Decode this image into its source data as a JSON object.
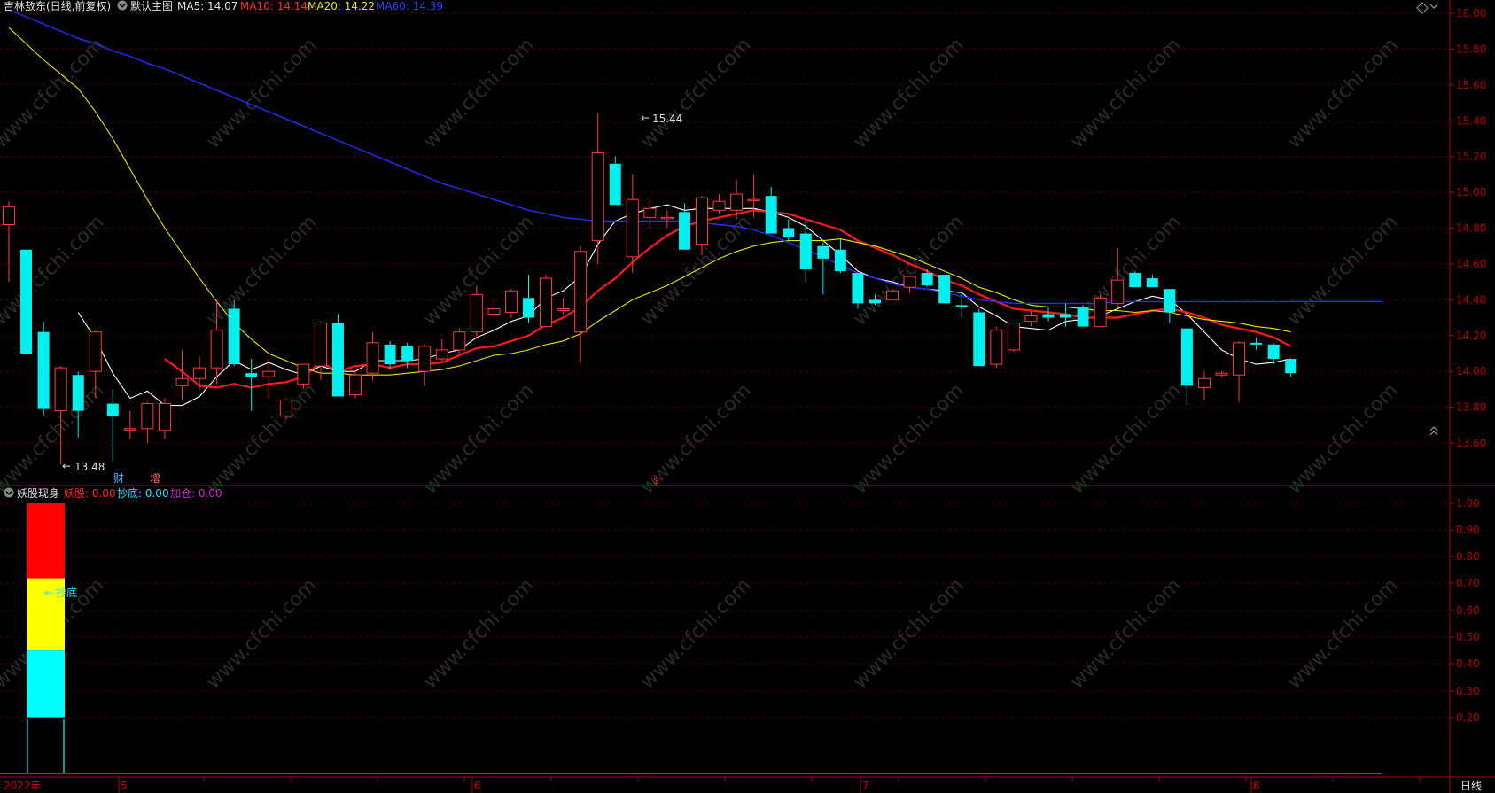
{
  "main_header": {
    "stock": "吉林敖东(日线,前复权)",
    "chart_name": "默认主图",
    "ma5": "MA5: 14.07",
    "ma10": "MA10: 14.14",
    "ma20": "MA20: 14.22",
    "ma60": "MA60: 14.39"
  },
  "indicator_header": {
    "name": "妖股现身",
    "yaogu": "妖股: 0.00",
    "chaodi": "抄底: 0.00",
    "jiacang": "加仓: 0.00"
  },
  "annotations": {
    "high": "15.44",
    "low": "13.48",
    "cai": "财",
    "zeng": "增",
    "chaodi_mark": "抄底",
    "dollar": "$"
  },
  "time_axis": {
    "labels": [
      "2022年",
      "5",
      "6",
      "7",
      "8"
    ],
    "period": "日线"
  },
  "watermark": "www.cfchi.com",
  "colors": {
    "up": "#ff3b3b",
    "down": "#00f0f0",
    "ma5": "#ffffff",
    "ma10": "#ff1a1a",
    "ma20": "#e6e600",
    "ma60": "#2030ff",
    "axis": "#b00000",
    "purple": "#cc00cc"
  },
  "chart_data": [
    {
      "type": "candlestick",
      "title": "吉林敖东(日线,前复权)",
      "y_ticks": [
        "16.00",
        "15.80",
        "15.60",
        "15.40",
        "15.20",
        "15.00",
        "14.80",
        "14.60",
        "14.40",
        "14.20",
        "14.00",
        "13.80",
        "13.60"
      ],
      "ylim": [
        13.45,
        16.05
      ],
      "candles": [
        [
          14.82,
          14.95,
          14.5,
          14.92
        ],
        [
          14.68,
          14.68,
          14.1,
          14.1
        ],
        [
          14.22,
          14.28,
          13.75,
          13.79
        ],
        [
          13.78,
          14.03,
          13.48,
          14.02
        ],
        [
          13.98,
          14.0,
          13.63,
          13.78
        ],
        [
          14.0,
          14.23,
          13.85,
          14.22
        ],
        [
          13.82,
          13.9,
          13.5,
          13.75
        ],
        [
          13.68,
          13.78,
          13.62,
          13.68
        ],
        [
          13.68,
          13.83,
          13.6,
          13.82
        ],
        [
          13.67,
          13.85,
          13.62,
          13.82
        ],
        [
          13.92,
          14.12,
          13.84,
          13.96
        ],
        [
          13.96,
          14.08,
          13.9,
          14.02
        ],
        [
          14.02,
          14.4,
          13.93,
          14.23
        ],
        [
          14.35,
          14.4,
          14.03,
          14.04
        ],
        [
          13.99,
          14.07,
          13.78,
          13.97
        ],
        [
          13.97,
          14.07,
          13.85,
          14.0
        ],
        [
          13.75,
          13.85,
          13.73,
          13.84
        ],
        [
          13.93,
          14.04,
          13.9,
          14.04
        ],
        [
          14.03,
          14.28,
          13.95,
          14.27
        ],
        [
          14.27,
          14.32,
          13.86,
          13.86
        ],
        [
          13.87,
          14.0,
          13.85,
          13.98
        ],
        [
          13.99,
          14.22,
          13.95,
          14.16
        ],
        [
          14.15,
          14.17,
          14.01,
          14.04
        ],
        [
          14.14,
          14.16,
          14.02,
          14.06
        ],
        [
          14.0,
          14.15,
          13.92,
          14.14
        ],
        [
          14.07,
          14.18,
          14.05,
          14.12
        ],
        [
          14.12,
          14.24,
          14.1,
          14.22
        ],
        [
          14.22,
          14.48,
          14.18,
          14.43
        ],
        [
          14.32,
          14.4,
          14.3,
          14.35
        ],
        [
          14.33,
          14.46,
          14.3,
          14.45
        ],
        [
          14.41,
          14.54,
          14.27,
          14.3
        ],
        [
          14.25,
          14.54,
          14.25,
          14.52
        ],
        [
          14.34,
          14.41,
          14.32,
          14.35
        ],
        [
          14.22,
          14.7,
          14.05,
          14.67
        ],
        [
          14.73,
          15.44,
          14.6,
          15.22
        ],
        [
          15.16,
          15.2,
          14.93,
          14.93
        ],
        [
          14.64,
          15.1,
          14.55,
          14.96
        ],
        [
          14.86,
          14.96,
          14.8,
          14.91
        ],
        [
          14.86,
          14.9,
          14.8,
          14.86
        ],
        [
          14.89,
          14.94,
          14.68,
          14.68
        ],
        [
          14.71,
          14.98,
          14.65,
          14.97
        ],
        [
          14.9,
          14.99,
          14.88,
          14.95
        ],
        [
          14.9,
          15.07,
          14.85,
          14.99
        ],
        [
          14.96,
          15.1,
          14.86,
          14.96
        ],
        [
          14.98,
          15.03,
          14.77,
          14.77
        ],
        [
          14.8,
          14.85,
          14.73,
          14.75
        ],
        [
          14.77,
          14.84,
          14.5,
          14.57
        ],
        [
          14.7,
          14.72,
          14.43,
          14.63
        ],
        [
          14.68,
          14.74,
          14.55,
          14.56
        ],
        [
          14.55,
          14.55,
          14.35,
          14.38
        ],
        [
          14.4,
          14.43,
          14.37,
          14.38
        ],
        [
          14.4,
          14.46,
          14.4,
          14.45
        ],
        [
          14.47,
          14.53,
          14.44,
          14.53
        ],
        [
          14.55,
          14.57,
          14.47,
          14.48
        ],
        [
          14.54,
          14.54,
          14.38,
          14.38
        ],
        [
          14.37,
          14.44,
          14.3,
          14.36
        ],
        [
          14.33,
          14.35,
          14.03,
          14.03
        ],
        [
          14.04,
          14.25,
          14.02,
          14.23
        ],
        [
          14.12,
          14.27,
          14.11,
          14.27
        ],
        [
          14.28,
          14.34,
          14.25,
          14.31
        ],
        [
          14.32,
          14.36,
          14.28,
          14.3
        ],
        [
          14.32,
          14.38,
          14.25,
          14.3
        ],
        [
          14.36,
          14.37,
          14.25,
          14.25
        ],
        [
          14.25,
          14.43,
          14.25,
          14.41
        ],
        [
          14.38,
          14.69,
          14.35,
          14.51
        ],
        [
          14.55,
          14.56,
          14.47,
          14.47
        ],
        [
          14.52,
          14.54,
          14.47,
          14.47
        ],
        [
          14.46,
          14.46,
          14.27,
          14.33
        ],
        [
          14.24,
          14.24,
          13.81,
          13.92
        ],
        [
          13.91,
          14.0,
          13.84,
          13.96
        ],
        [
          13.98,
          14.0,
          13.97,
          13.99
        ],
        [
          13.98,
          14.17,
          13.83,
          14.16
        ],
        [
          14.16,
          14.19,
          14.12,
          14.15
        ],
        [
          14.15,
          14.16,
          14.04,
          14.07
        ],
        [
          14.07,
          14.07,
          13.97,
          13.99
        ]
      ],
      "series": [
        {
          "name": "MA5",
          "values": [
            null,
            null,
            null,
            null,
            14.33,
            14.18,
            13.99,
            13.85,
            13.89,
            13.81,
            13.81,
            13.86,
            13.97,
            14.06,
            14.01,
            14.05,
            14.01,
            13.98,
            14.03,
            14.0,
            14.0,
            14.06,
            14.06,
            14.06,
            14.07,
            14.1,
            14.12,
            14.19,
            14.23,
            14.28,
            14.31,
            14.41,
            14.45,
            14.53,
            14.71,
            14.84,
            14.88,
            14.91,
            14.93,
            14.9,
            14.91,
            14.91,
            14.91,
            14.91,
            14.89,
            14.86,
            14.81,
            14.73,
            14.65,
            14.56,
            14.52,
            14.5,
            14.47,
            14.46,
            14.45,
            14.44,
            14.36,
            14.31,
            14.25,
            14.24,
            14.23,
            14.28,
            14.29,
            14.31,
            14.35,
            14.39,
            14.42,
            14.4,
            14.32,
            14.22,
            14.12,
            14.07,
            14.04,
            14.05,
            14.07
          ]
        },
        {
          "name": "MA10",
          "values": [
            null,
            null,
            null,
            null,
            null,
            null,
            null,
            null,
            null,
            14.07,
            14.0,
            13.92,
            13.91,
            13.93,
            13.91,
            13.93,
            13.94,
            13.97,
            14.05,
            14.0,
            14.03,
            14.04,
            14.02,
            14.04,
            14.04,
            14.05,
            14.09,
            14.13,
            14.14,
            14.17,
            14.2,
            14.26,
            14.3,
            14.36,
            14.45,
            14.52,
            14.61,
            14.69,
            14.76,
            14.81,
            14.84,
            14.86,
            14.88,
            14.9,
            14.89,
            14.88,
            14.85,
            14.82,
            14.79,
            14.73,
            14.69,
            14.65,
            14.6,
            14.56,
            14.51,
            14.48,
            14.43,
            14.39,
            14.35,
            14.34,
            14.33,
            14.32,
            14.3,
            14.3,
            14.3,
            14.32,
            14.34,
            14.35,
            14.33,
            14.3,
            14.26,
            14.24,
            14.22,
            14.19,
            14.14
          ]
        },
        {
          "name": "MA20",
          "values": [
            15.92,
            15.83,
            15.74,
            15.66,
            15.58,
            15.45,
            15.3,
            15.13,
            14.96,
            14.8,
            14.66,
            14.52,
            14.39,
            14.27,
            14.18,
            14.1,
            14.06,
            14.02,
            13.99,
            13.99,
            13.98,
            13.98,
            13.98,
            13.99,
            14.0,
            14.01,
            14.03,
            14.06,
            14.09,
            14.1,
            14.12,
            14.15,
            14.17,
            14.21,
            14.28,
            14.34,
            14.4,
            14.44,
            14.48,
            14.53,
            14.58,
            14.63,
            14.67,
            14.7,
            14.72,
            14.73,
            14.73,
            14.73,
            14.74,
            14.72,
            14.7,
            14.67,
            14.64,
            14.6,
            14.56,
            14.52,
            14.47,
            14.44,
            14.4,
            14.37,
            14.36,
            14.36,
            14.35,
            14.34,
            14.34,
            14.33,
            14.34,
            14.33,
            14.31,
            14.29,
            14.28,
            14.27,
            14.25,
            14.24,
            14.22
          ]
        },
        {
          "name": "MA60",
          "values": [
            16.02,
            15.98,
            15.94,
            15.9,
            15.86,
            15.83,
            15.79,
            15.76,
            15.72,
            15.69,
            15.65,
            15.61,
            15.57,
            15.53,
            15.49,
            15.45,
            15.41,
            15.37,
            15.33,
            15.29,
            15.25,
            15.21,
            15.17,
            15.13,
            15.09,
            15.05,
            15.02,
            14.99,
            14.96,
            14.93,
            14.9,
            14.88,
            14.86,
            14.85,
            14.84,
            14.84,
            14.84,
            14.84,
            14.84,
            14.84,
            14.83,
            14.82,
            14.81,
            14.79,
            14.76,
            14.72,
            14.68,
            14.64,
            14.59,
            14.55,
            14.52,
            14.49,
            14.47,
            14.46,
            14.44,
            14.42,
            14.4,
            14.39,
            14.38,
            14.38,
            14.38,
            14.38,
            14.38,
            14.38,
            14.39,
            14.39,
            14.39,
            14.39,
            14.39,
            14.39,
            14.39,
            14.39,
            14.39,
            14.39,
            14.39
          ]
        }
      ]
    },
    {
      "type": "bar",
      "title": "妖股现身",
      "y_ticks": [
        "1.00",
        "0.90",
        "0.80",
        "0.70",
        "0.60",
        "0.50",
        "0.40",
        "0.30",
        "0.20"
      ],
      "ylim": [
        0,
        1.05
      ],
      "stacked_bar_segments": [
        {
          "name": "红",
          "from": 0.72,
          "to": 1.0
        },
        {
          "name": "黄",
          "from": 0.45,
          "to": 0.72
        },
        {
          "name": "青",
          "from": 0.2,
          "to": 0.45
        }
      ]
    }
  ]
}
